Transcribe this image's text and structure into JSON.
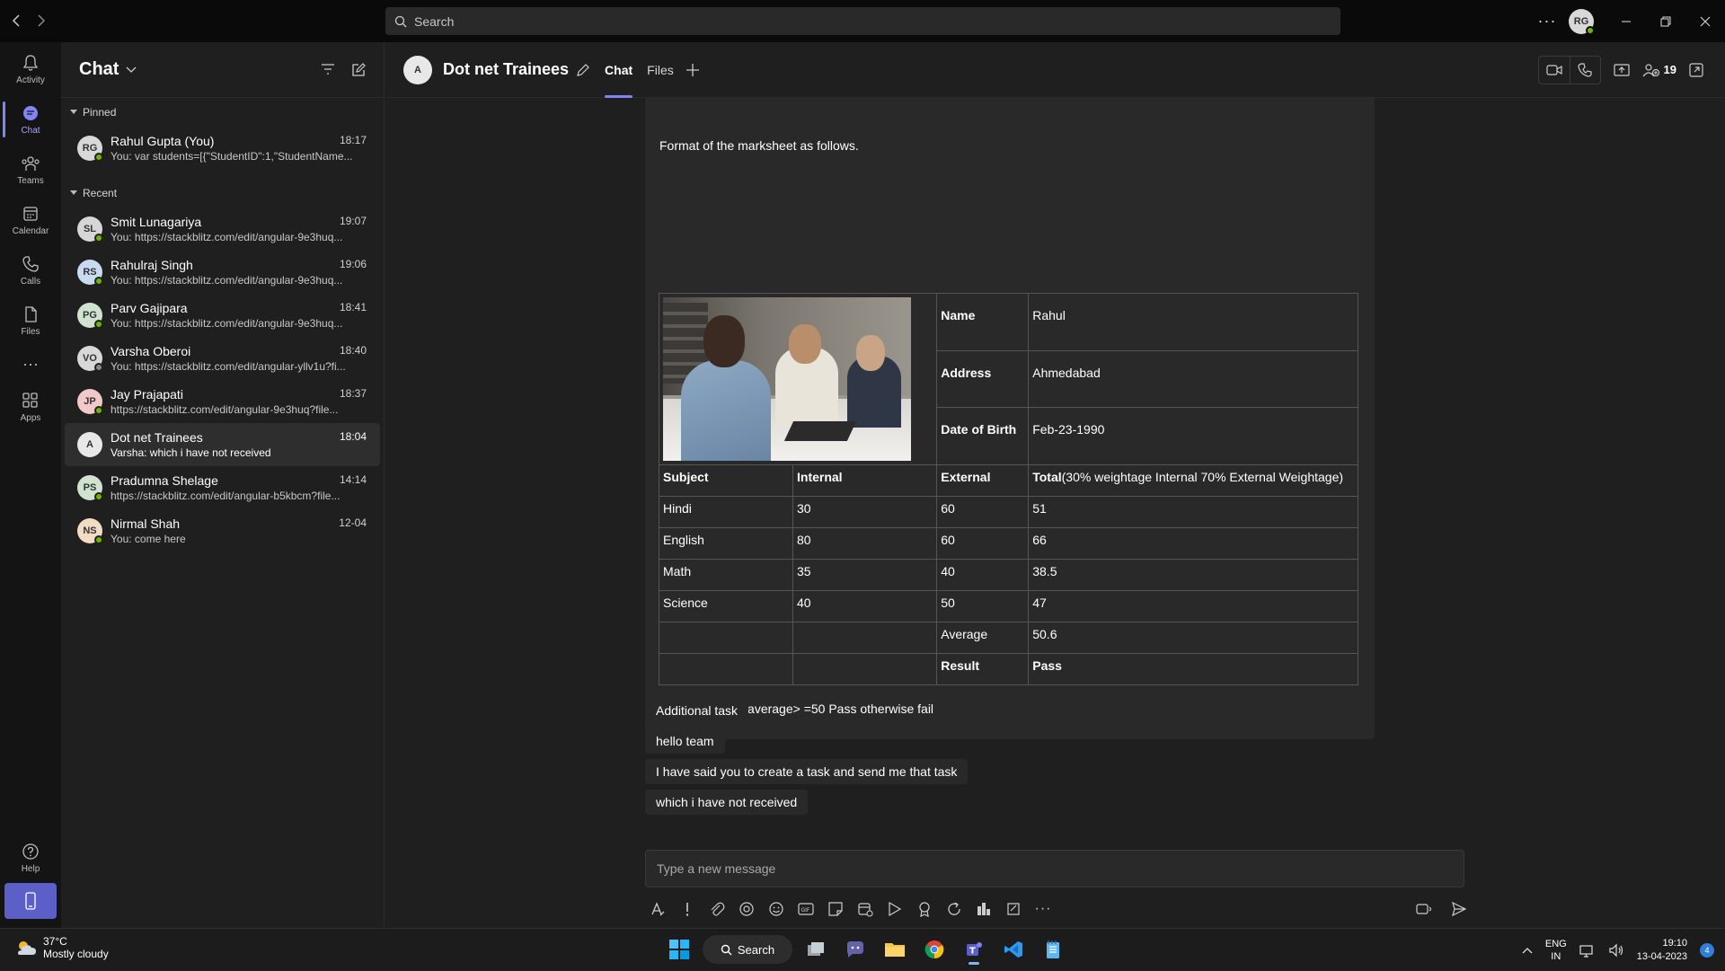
{
  "search": {
    "placeholder": "Search"
  },
  "user": {
    "initials": "RG"
  },
  "rail": [
    {
      "label": "Activity"
    },
    {
      "label": "Chat"
    },
    {
      "label": "Teams"
    },
    {
      "label": "Calendar"
    },
    {
      "label": "Calls"
    },
    {
      "label": "Files"
    },
    {
      "label": "Apps"
    },
    {
      "label": "Help"
    }
  ],
  "chatlist": {
    "title": "Chat",
    "pinned_label": "Pinned",
    "recent_label": "Recent",
    "pinned": [
      {
        "initials": "RG",
        "name": "Rahul Gupta (You)",
        "time": "18:17",
        "preview": "You: var students=[{\"StudentID\":1,\"StudentName..."
      }
    ],
    "recent": [
      {
        "initials": "SL",
        "name": "Smit Lunagariya",
        "time": "19:07",
        "preview": "You: https://stackblitz.com/edit/angular-9e3huq...",
        "color": "#d6d6d6"
      },
      {
        "initials": "RS",
        "name": "Rahulraj Singh",
        "time": "19:06",
        "preview": "You: https://stackblitz.com/edit/angular-9e3huq...",
        "color": "#c9dcef"
      },
      {
        "initials": "PG",
        "name": "Parv Gajipara",
        "time": "18:41",
        "preview": "You: https://stackblitz.com/edit/angular-9e3huq...",
        "color": "#cfe3cf"
      },
      {
        "initials": "VO",
        "name": "Varsha Oberoi",
        "time": "18:40",
        "preview": "You: https://stackblitz.com/edit/angular-yllv1u?fi...",
        "color": "#d8d8d8"
      },
      {
        "initials": "JP",
        "name": "Jay Prajapati",
        "time": "18:37",
        "preview": "https://stackblitz.com/edit/angular-9e3huq?file...",
        "color": "#f1c9c9"
      },
      {
        "initials": "A",
        "name": "Dot net Trainees",
        "time": "18:04",
        "preview": "Varsha: which i have not received",
        "color": "#e8e8e8"
      },
      {
        "initials": "PS",
        "name": "Pradumna Shelage",
        "time": "14:14",
        "preview": "https://stackblitz.com/edit/angular-b5kbcm?file...",
        "color": "#cfe3cf"
      },
      {
        "initials": "NS",
        "name": "Nirmal Shah",
        "time": "12-04",
        "preview": "You: come here",
        "color": "#f3dcc4"
      }
    ]
  },
  "conversation": {
    "initials": "A",
    "title": "Dot net Trainees",
    "tabs": [
      "Chat",
      "Files"
    ],
    "participants": "19",
    "message": {
      "intro": "Format of the marksheet as follows.",
      "info": [
        {
          "label": "Name",
          "value": "Rahul"
        },
        {
          "label": "Address",
          "value": "Ahmedabad"
        },
        {
          "label": "Date of Birth",
          "value": "Feb-23-1990"
        }
      ],
      "header": {
        "subject": "Subject",
        "internal": "Internal",
        "external": "External",
        "total_bold": "Total",
        "total_rest": "(30% weightage Internal 70% External Weightage)"
      },
      "rows": [
        {
          "subject": "Hindi",
          "internal": "30",
          "external": "60",
          "total": "51"
        },
        {
          "subject": "English",
          "internal": "80",
          "external": "60",
          "total": "66"
        },
        {
          "subject": "Math",
          "internal": "35",
          "external": "40",
          "total": "38.5"
        },
        {
          "subject": "Science",
          "internal": "40",
          "external": "50",
          "total": "47"
        }
      ],
      "average_label": "Average",
      "average_value": "50.6",
      "result_label": "Result",
      "result_value": "Pass",
      "formula": "Result formula: average> =50 Pass otherwise fail"
    },
    "bubbles": [
      "Additional task",
      "hello team",
      "I have said you to create a task and send me that task",
      "which i have not received"
    ],
    "composer_placeholder": "Type a new message"
  },
  "taskbar": {
    "temperature": "37°C",
    "weather": "Mostly cloudy",
    "search_label": "Search",
    "lang1": "ENG",
    "lang2": "IN",
    "time": "19:10",
    "date": "13-04-2023",
    "notifications": "4"
  }
}
